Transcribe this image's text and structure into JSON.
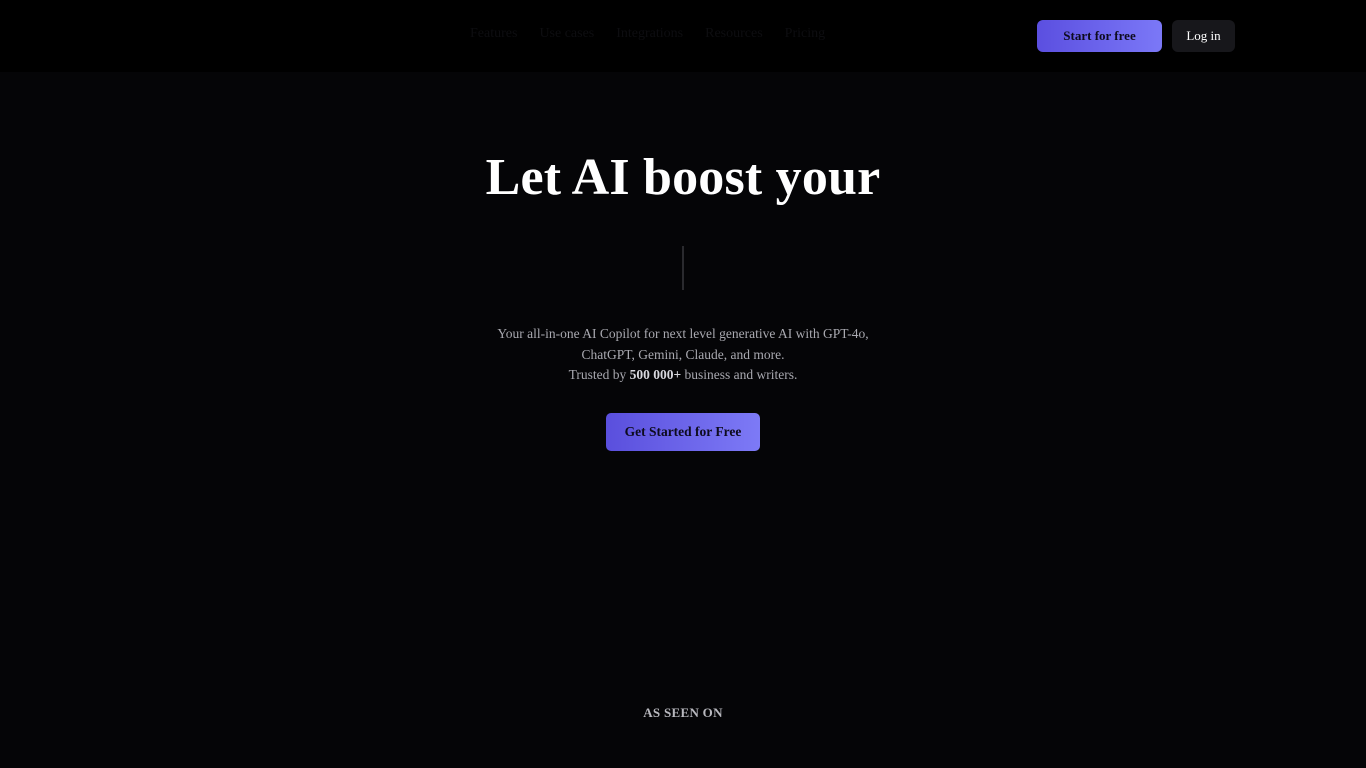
{
  "header": {
    "nav_items": [
      "Features",
      "Use cases",
      "Integrations",
      "Resources",
      "Pricing"
    ],
    "start_label": "Start for free",
    "login_label": "Log in"
  },
  "hero": {
    "title": "Let AI boost your",
    "subtitle_line1": "Your all-in-one AI Copilot for next level generative AI with GPT-4o,",
    "subtitle_line2": "ChatGPT, Gemini, Claude, and more.",
    "trusted_prefix": "Trusted by ",
    "trusted_count": "500 000+",
    "trusted_suffix": " business and writers.",
    "cta_label": "Get Started for Free"
  },
  "press": {
    "label": "AS SEEN ON"
  },
  "colors": {
    "background": "#050507",
    "accent_start": "#5b4fe0",
    "accent_end": "#7b78f7"
  }
}
